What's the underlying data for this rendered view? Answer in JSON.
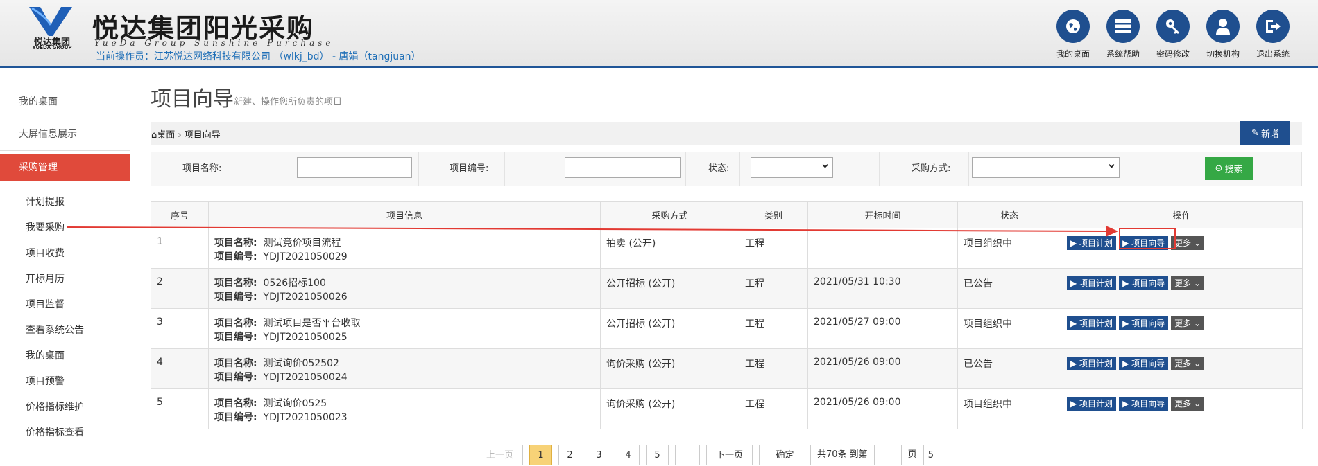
{
  "header": {
    "title": "悦达集团阳光采购",
    "title_en": "YueDa Group Sunshine Purchase",
    "logo_text": "悦达集团",
    "logo_text_en": "YUEDA GROUP",
    "operator": "当前操作员：江苏悦达网络科技有限公司 （wlkj_bd） - 唐娟（tangjuan）",
    "buttons": [
      {
        "label": "我的桌面",
        "icon": "globe-icon"
      },
      {
        "label": "系统帮助",
        "icon": "server-icon"
      },
      {
        "label": "密码修改",
        "icon": "key-icon"
      },
      {
        "label": "切换机构",
        "icon": "user-icon"
      },
      {
        "label": "退出系统",
        "icon": "logout-icon"
      }
    ],
    "accent": "#1f4f8f"
  },
  "sidebar": {
    "top_items": [
      "我的桌面",
      "大屏信息展示"
    ],
    "active": "采购管理",
    "sub_items": [
      "计划提报",
      "我要采购",
      "项目收费",
      "开标月历",
      "项目监督",
      "查看系统公告",
      "我的桌面",
      "项目预警",
      "价格指标维护",
      "价格指标查看"
    ],
    "active_color": "#e04a3b"
  },
  "page": {
    "title": "项目向导",
    "desc": "新建、操作您所负责的项目",
    "breadcrumb_home": "桌面",
    "breadcrumb_current": "项目向导",
    "new_button": "新增"
  },
  "search": {
    "name_label": "项目名称:",
    "code_label": "项目编号:",
    "status_label": "状态:",
    "method_label": "采购方式:",
    "search_button": "搜索"
  },
  "table": {
    "columns": [
      "序号",
      "项目信息",
      "采购方式",
      "类别",
      "开标时间",
      "状态",
      "操作"
    ],
    "name_label": "项目名称:",
    "code_label": "项目编号:",
    "rows": [
      {
        "no": "1",
        "name": "测试竞价项目流程",
        "code": "YDJT2021050029",
        "method": "拍卖 (公开)",
        "category": "工程",
        "open_time": "",
        "status": "项目组织中"
      },
      {
        "no": "2",
        "name": "0526招标100",
        "code": "YDJT2021050026",
        "method": "公开招标 (公开)",
        "category": "工程",
        "open_time": "2021/05/31 10:30",
        "status": "已公告"
      },
      {
        "no": "3",
        "name": "测试项目是否平台收取",
        "code": "YDJT2021050025",
        "method": "公开招标 (公开)",
        "category": "工程",
        "open_time": "2021/05/27 09:00",
        "status": "项目组织中"
      },
      {
        "no": "4",
        "name": "测试询价052502",
        "code": "YDJT2021050024",
        "method": "询价采购 (公开)",
        "category": "工程",
        "open_time": "2021/05/26 09:00",
        "status": "已公告"
      },
      {
        "no": "5",
        "name": "测试询价0525",
        "code": "YDJT2021050023",
        "method": "询价采购 (公开)",
        "category": "工程",
        "open_time": "2021/05/26 09:00",
        "status": "项目组织中"
      }
    ],
    "op_plan": "项目计划",
    "op_guide": "项目向导",
    "op_more": "更多"
  },
  "pager": {
    "prev": "上一页",
    "pages": [
      "1",
      "2",
      "3",
      "4",
      "5",
      ""
    ],
    "next": "下一页",
    "confirm": "确定",
    "total": "共70条 到第",
    "page_unit": "页",
    "page_size": "5"
  }
}
